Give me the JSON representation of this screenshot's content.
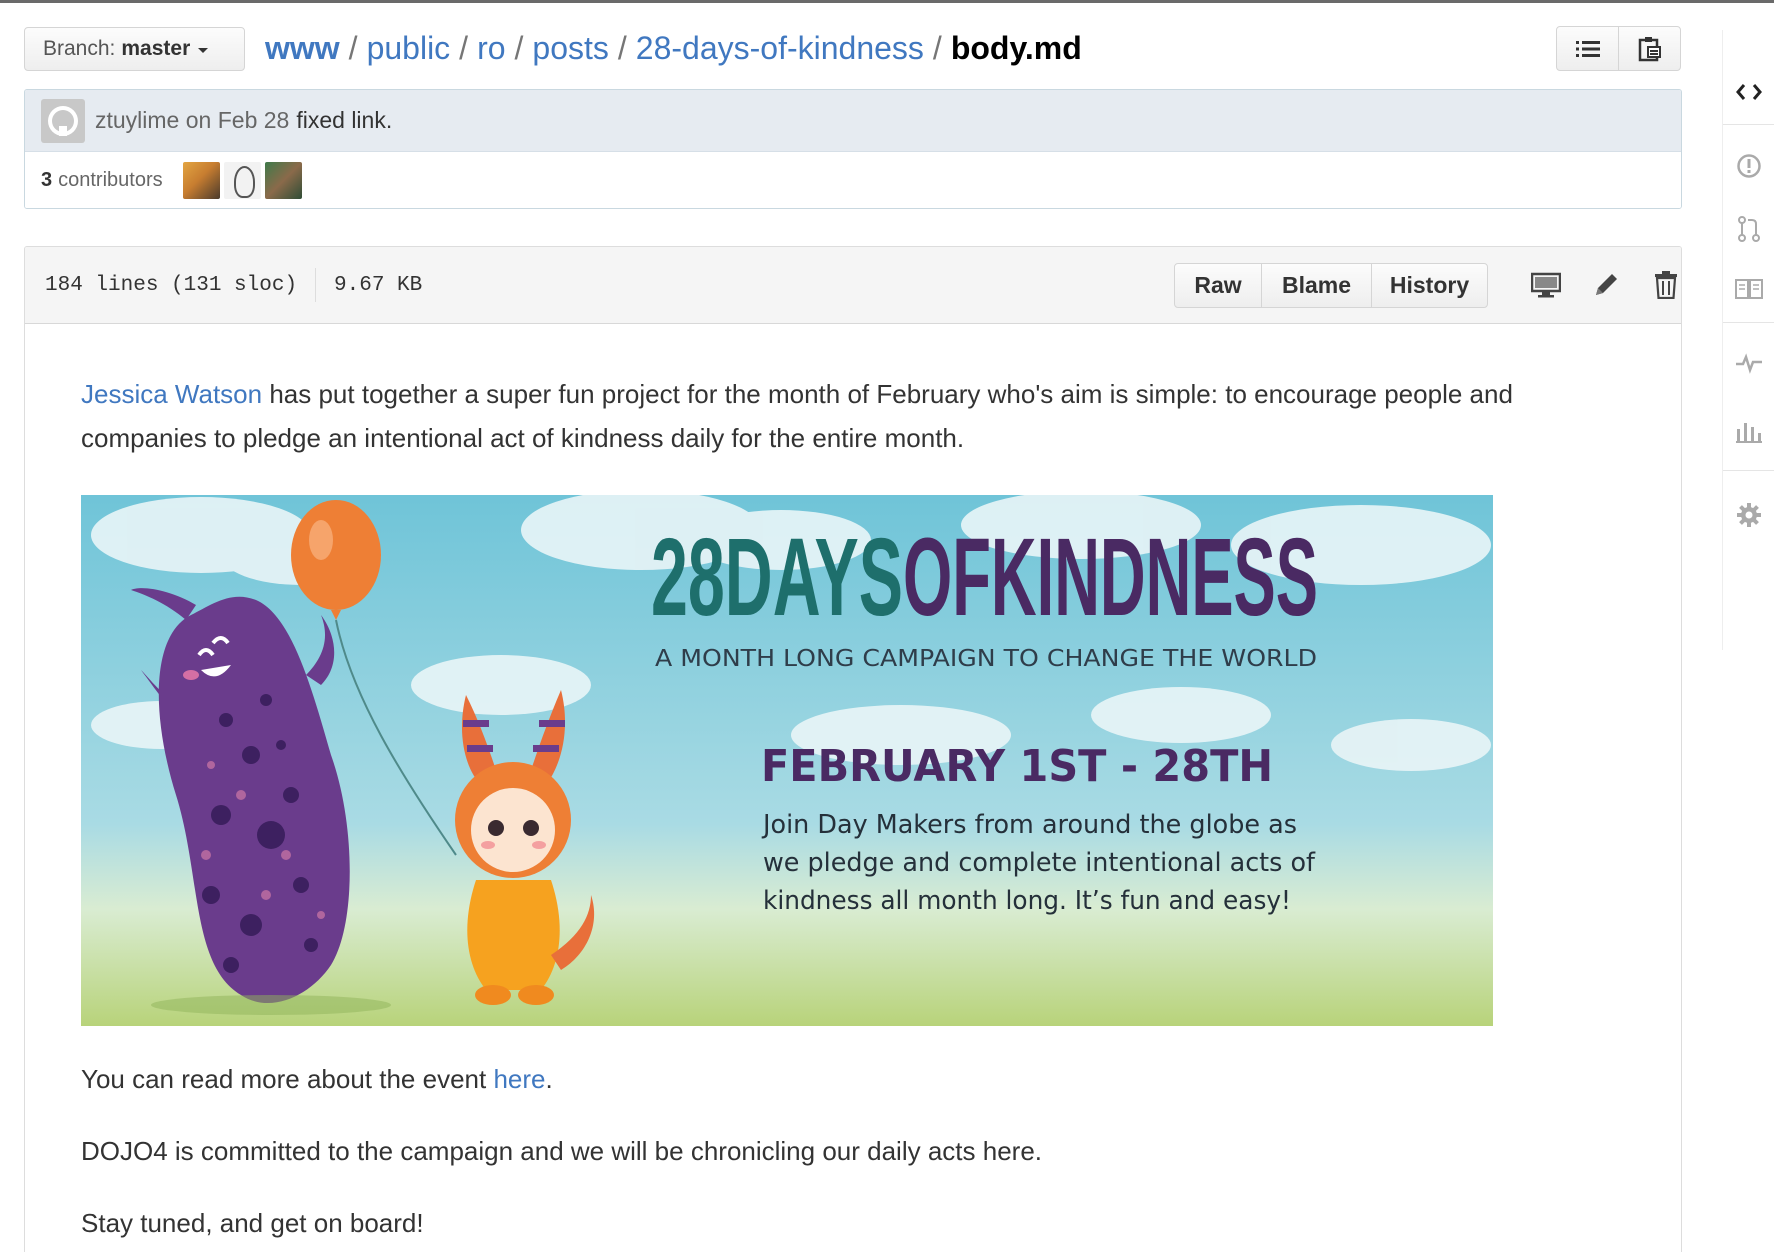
{
  "branch": {
    "label": "Branch:",
    "value": "master"
  },
  "breadcrumb": {
    "items": [
      "www",
      "public",
      "ro",
      "posts",
      "28-days-of-kindness"
    ],
    "separator": "/",
    "current": "body.md"
  },
  "commit": {
    "author": "ztuylime",
    "date": "on Feb 28",
    "message": "fixed link.",
    "contributors_count": "3",
    "contributors_label": "contributors"
  },
  "file": {
    "lines": "184 lines (131 sloc)",
    "size": "9.67 KB",
    "buttons": {
      "raw": "Raw",
      "blame": "Blame",
      "history": "History"
    }
  },
  "content": {
    "intro_link": "Jessica Watson",
    "intro_text": " has put together a super fun project for the month of February who's aim is simple: to encourage people and companies to pledge an intentional act of kindness daily for the entire month.",
    "banner": {
      "title_part1": "28DAYS",
      "title_part2": "OFKINDNESS",
      "subtitle": "A MONTH LONG CAMPAIGN TO CHANGE THE WORLD",
      "dates": "FEBRUARY 1ST - 28TH",
      "line1": "Join Day Makers from around the globe as",
      "line2": "we pledge and complete intentional acts of",
      "line3": "kindness all month long. It’s fun and easy!"
    },
    "para2_before": "You can read more about the event ",
    "para2_link": "here",
    "para2_after": ".",
    "para3": "DOJO4 is committed to the campaign and we will be chronicling our daily acts here.",
    "para4": "Stay tuned, and get on board!"
  },
  "colors": {
    "link": "#4078c0",
    "banner_teal": "#1e6f6c",
    "banner_purple": "#4a2a63",
    "monster_purple": "#6a3c8c",
    "balloon_orange": "#ee7f35"
  },
  "icons": {
    "top_buttons": [
      "list-icon",
      "clipboard-icon"
    ],
    "file_actions": [
      "desktop-icon",
      "pencil-icon",
      "trash-icon"
    ],
    "sidebar": [
      "code-icon",
      "issue-icon",
      "pull-request-icon",
      "wiki-icon",
      "pulse-icon",
      "graph-icon",
      "settings-icon"
    ]
  }
}
